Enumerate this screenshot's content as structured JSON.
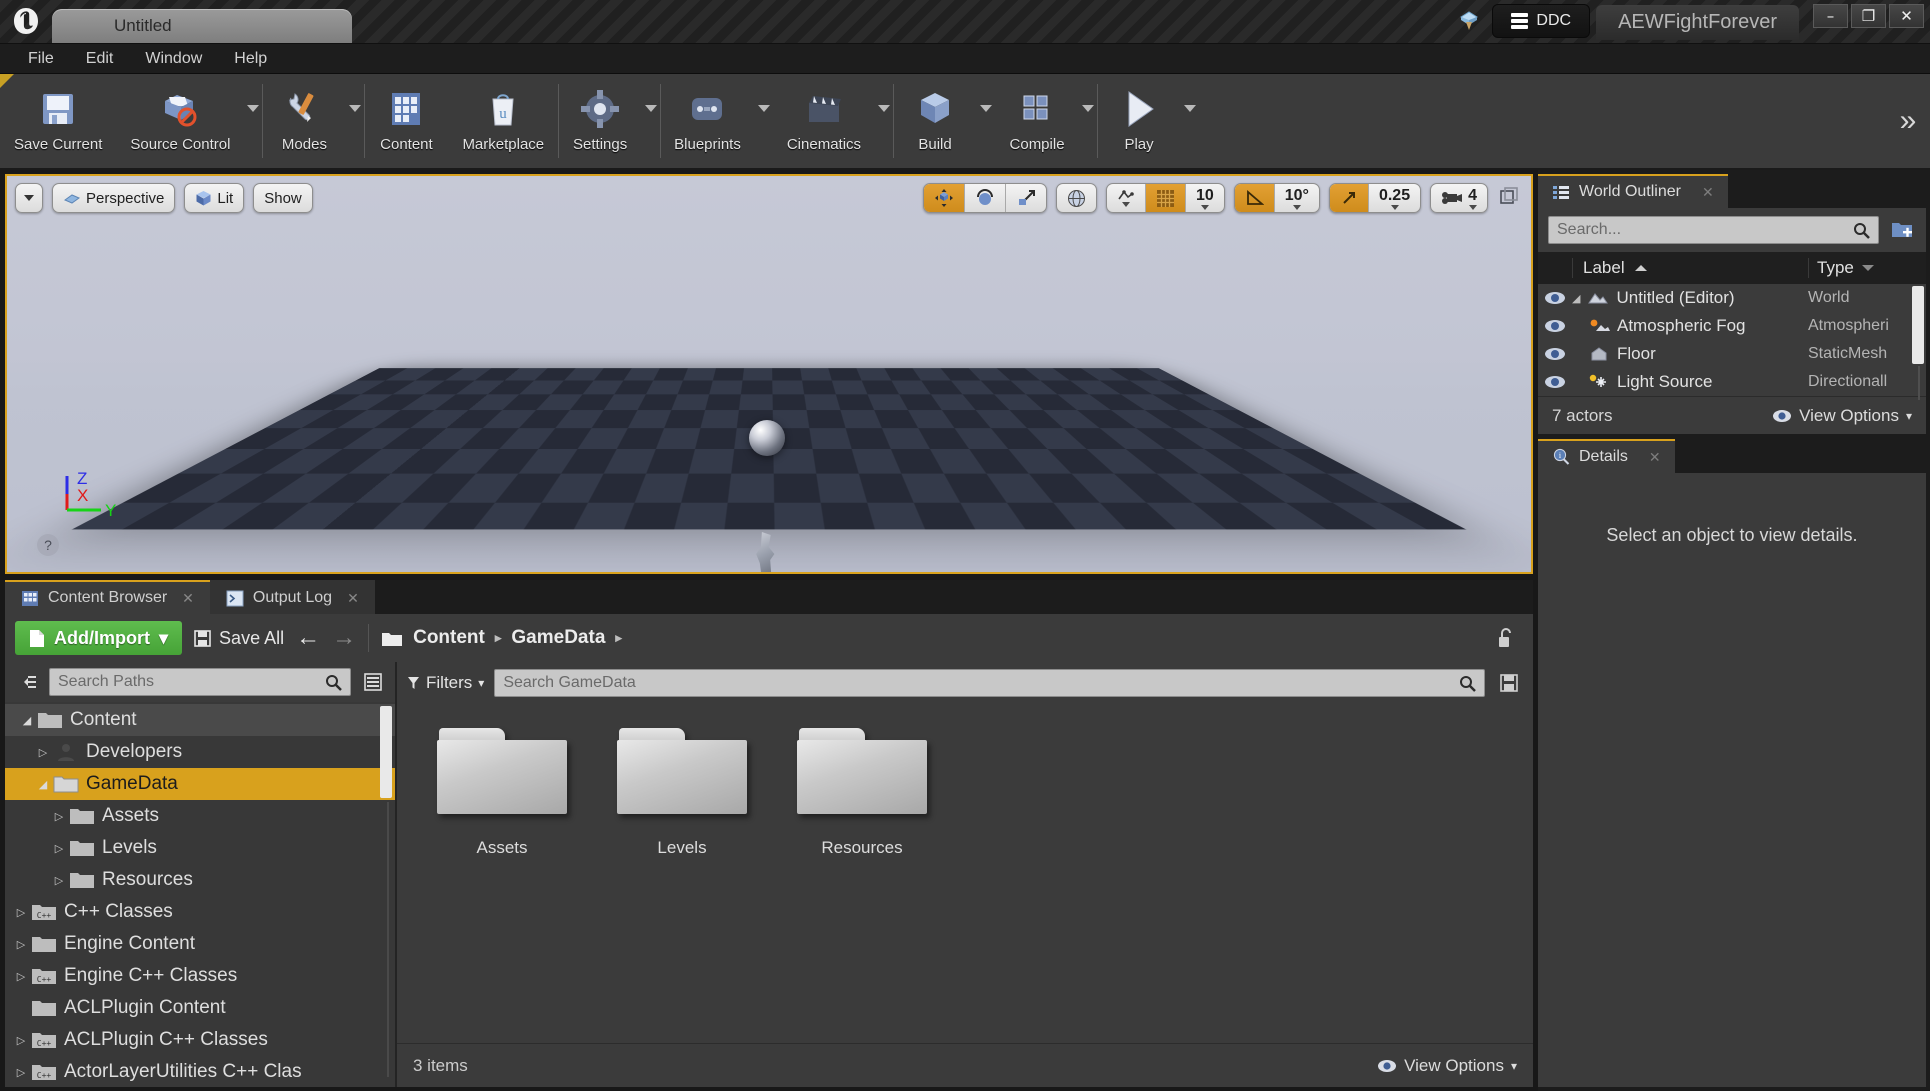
{
  "titlebar": {
    "logo": "unreal-logo",
    "project_tab": "Untitled",
    "ddc_label": "DDC",
    "project_name": "AEWFightForever",
    "minimize": "–",
    "maximize": "❐",
    "close": "✕"
  },
  "menubar": {
    "items": [
      "File",
      "Edit",
      "Window",
      "Help"
    ]
  },
  "toolbar": {
    "groups": [
      {
        "buttons": [
          {
            "label": "Save Current",
            "icon": "floppy-disk-icon",
            "caret": false
          },
          {
            "label": "Source Control",
            "icon": "source-control-icon",
            "caret": true
          }
        ]
      },
      {
        "buttons": [
          {
            "label": "Modes",
            "icon": "wrench-pencil-icon",
            "caret": true
          }
        ]
      },
      {
        "buttons": [
          {
            "label": "Content",
            "icon": "content-grid-icon",
            "caret": false
          },
          {
            "label": "Marketplace",
            "icon": "marketplace-bag-icon",
            "caret": false
          }
        ]
      },
      {
        "buttons": [
          {
            "label": "Settings",
            "icon": "gear-icon",
            "caret": true
          }
        ]
      },
      {
        "buttons": [
          {
            "label": "Blueprints",
            "icon": "blueprint-icon",
            "caret": true
          },
          {
            "label": "Cinematics",
            "icon": "clapperboard-icon",
            "caret": true
          }
        ]
      },
      {
        "buttons": [
          {
            "label": "Build",
            "icon": "build-cube-icon",
            "caret": true
          },
          {
            "label": "Compile",
            "icon": "compile-cubes-icon",
            "caret": true
          }
        ]
      },
      {
        "buttons": [
          {
            "label": "Play",
            "icon": "play-icon",
            "caret": true
          }
        ]
      }
    ],
    "expand": "»"
  },
  "viewport": {
    "view_menu_caret": "view-options-caret",
    "camera_mode": "Perspective",
    "view_mode": "Lit",
    "show_menu": "Show",
    "transform": {
      "translate": "move-gizmo-icon",
      "rotate": "rotate-gizmo-icon",
      "scale": "scale-gizmo-icon",
      "coordinate_system": "world-globe-icon"
    },
    "surface_snap": "surface-snap-icon",
    "grid_snap_enabled": true,
    "grid_snap_value": "10",
    "angle_snap_enabled": true,
    "angle_snap_value": "10°",
    "scale_snap_enabled": true,
    "scale_snap_value": "0.25",
    "camera_speed_icon": "camera-speed-icon",
    "camera_speed_value": "4",
    "maximize_icon": "maximize-viewport-icon",
    "axis": {
      "x": "X",
      "y": "Y",
      "z": "Z",
      "x_color": "#e01b1b",
      "y_color": "#17d317",
      "z_color": "#2d2de6"
    },
    "help_icon": "?"
  },
  "content_browser": {
    "tabs": [
      {
        "label": "Content Browser",
        "icon": "content-browser-icon",
        "active": true,
        "close": "✕"
      },
      {
        "label": "Output Log",
        "icon": "output-log-icon",
        "active": false,
        "close": "✕"
      }
    ],
    "add_import": "Add/Import",
    "add_import_caret": "▾",
    "save_all": "Save All",
    "nav_back": "←",
    "nav_forward": "→",
    "breadcrumb": [
      "Content",
      "GameData"
    ],
    "breadcrumb_sep": "▸",
    "lock_icon": "lock-open-icon",
    "paths_search_placeholder": "Search Paths",
    "paths_filter_icon": "collapse-tree-icon",
    "paths_options_icon": "path-options-icon",
    "filters_label": "Filters",
    "asset_search_placeholder": "Search GameData",
    "save_search_icon": "save-search-icon",
    "tree": [
      {
        "label": "Content",
        "depth": 0,
        "arrow": "open",
        "icon": "folder-icon",
        "state": "highlight"
      },
      {
        "label": "Developers",
        "depth": 1,
        "arrow": "closed",
        "icon": "person-icon",
        "state": "none"
      },
      {
        "label": "GameData",
        "depth": 1,
        "arrow": "open",
        "icon": "folder-icon",
        "state": "selected"
      },
      {
        "label": "Assets",
        "depth": 2,
        "arrow": "closed",
        "icon": "folder-icon",
        "state": "none"
      },
      {
        "label": "Levels",
        "depth": 2,
        "arrow": "closed",
        "icon": "folder-icon",
        "state": "none"
      },
      {
        "label": "Resources",
        "depth": 2,
        "arrow": "closed",
        "icon": "folder-icon",
        "state": "none"
      },
      {
        "label": "C++ Classes",
        "depth": 0,
        "arrow": "closed",
        "icon": "cpp-folder-icon",
        "state": "none"
      },
      {
        "label": "Engine Content",
        "depth": 0,
        "arrow": "closed",
        "icon": "folder-icon",
        "state": "none"
      },
      {
        "label": "Engine C++ Classes",
        "depth": 0,
        "arrow": "closed",
        "icon": "cpp-folder-icon",
        "state": "none"
      },
      {
        "label": "ACLPlugin Content",
        "depth": 0,
        "arrow": "none",
        "icon": "folder-icon",
        "state": "none"
      },
      {
        "label": "ACLPlugin C++ Classes",
        "depth": 0,
        "arrow": "closed",
        "icon": "cpp-folder-icon",
        "state": "none"
      },
      {
        "label": "ActorLayerUtilities C++ Clas",
        "depth": 0,
        "arrow": "closed",
        "icon": "cpp-folder-icon",
        "state": "none"
      }
    ],
    "assets": [
      {
        "name": "Assets",
        "type": "folder"
      },
      {
        "name": "Levels",
        "type": "folder"
      },
      {
        "name": "Resources",
        "type": "folder"
      }
    ],
    "status": "3 items",
    "view_options": "View Options",
    "view_options_caret": "▾"
  },
  "world_outliner": {
    "tab_label": "World Outliner",
    "tab_icon": "outliner-list-icon",
    "tab_close": "✕",
    "search_placeholder": "Search...",
    "add_icon": "add-folder-icon",
    "columns": {
      "label": "Label",
      "type": "Type"
    },
    "rows": [
      {
        "label": "Untitled (Editor)",
        "type": "World",
        "icon": "world-icon",
        "depth": 0,
        "expander": true
      },
      {
        "label": "Atmospheric Fog",
        "type": "Atmospheri",
        "icon": "fog-icon",
        "depth": 1,
        "expander": false
      },
      {
        "label": "Floor",
        "type": "StaticMesh",
        "icon": "staticmesh-icon",
        "depth": 1,
        "expander": false
      },
      {
        "label": "Light Source",
        "type": "Directionall",
        "icon": "light-icon",
        "depth": 1,
        "expander": false
      }
    ],
    "actor_count": "7 actors",
    "view_options": "View Options",
    "view_options_caret": "▾"
  },
  "details": {
    "tab_label": "Details",
    "tab_icon": "details-magnifier-icon",
    "tab_close": "✕",
    "empty_message": "Select an object to view details."
  },
  "colors": {
    "accent_gold": "#d8a11d",
    "green_button": "#46a337",
    "panel_bg": "#3b3b3b",
    "toolbar_bg": "#3b3b3b",
    "dark_bg": "#1c1c1c"
  }
}
